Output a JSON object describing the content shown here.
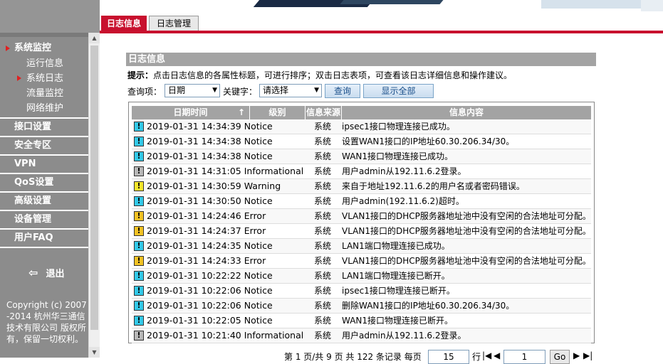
{
  "sidebar": {
    "groups": [
      {
        "label": "系统监控"
      },
      {
        "label": "接口设置"
      },
      {
        "label": "安全专区"
      },
      {
        "label": "VPN"
      },
      {
        "label": "QoS设置"
      },
      {
        "label": "高级设置"
      },
      {
        "label": "设备管理"
      },
      {
        "label": "用户FAQ"
      }
    ],
    "sub_items": [
      {
        "label": "运行信息"
      },
      {
        "label": "系统日志"
      },
      {
        "label": "流量监控"
      },
      {
        "label": "网络维护"
      }
    ],
    "logout_label": "退出",
    "copyright": "Copyright (c) 2007-2014 杭州华三通信技术有限公司 版权所有，保留一切权利。"
  },
  "tabs": [
    {
      "label": "日志信息"
    },
    {
      "label": "日志管理"
    }
  ],
  "panel": {
    "title": "日志信息",
    "tip_prefix": "提示：",
    "tip_text": "点击日志信息的各属性标题，可进行排序；双击日志表项，可查看该日志详细信息和操作建议。",
    "query_label": "查询项：",
    "query_value": "日期",
    "keyword_label": "关键字：",
    "keyword_value": "请选择",
    "search_button": "查询",
    "show_all_button": "显示全部"
  },
  "table": {
    "headers": [
      "日期时间",
      "级别",
      "信息来源",
      "信息内容"
    ],
    "sort_indicator": "↑",
    "rows": [
      {
        "level_icon": "notice-icon",
        "icon_char": "!",
        "datetime": "2019-01-31 14:34:39",
        "level": "Notice",
        "source": "系统",
        "message": "ipsec1接口物理连接已成功。"
      },
      {
        "level_icon": "notice-icon",
        "icon_char": "!",
        "datetime": "2019-01-31 14:34:38",
        "level": "Notice",
        "source": "系统",
        "message": "设置WAN1接口的IP地址60.30.206.34/30。"
      },
      {
        "level_icon": "notice-icon",
        "icon_char": "!",
        "datetime": "2019-01-31 14:34:38",
        "level": "Notice",
        "source": "系统",
        "message": "WAN1接口物理连接已成功。"
      },
      {
        "level_icon": "informational-icon",
        "icon_char": "!",
        "datetime": "2019-01-31 14:31:05",
        "level": "Informational",
        "source": "系统",
        "message": "用户admin从192.11.6.2登录。"
      },
      {
        "level_icon": "warning-icon",
        "icon_char": "!",
        "datetime": "2019-01-31 14:30:59",
        "level": "Warning",
        "source": "系统",
        "message": "来自于地址192.11.6.2的用户名或者密码错误。"
      },
      {
        "level_icon": "notice-icon",
        "icon_char": "!",
        "datetime": "2019-01-31 14:30:50",
        "level": "Notice",
        "source": "系统",
        "message": "用户admin(192.11.6.2)超时。"
      },
      {
        "level_icon": "error-icon",
        "icon_char": "!",
        "datetime": "2019-01-31 14:24:46",
        "level": "Error",
        "source": "系统",
        "message": "VLAN1接口的DHCP服务器地址池中没有空闲的合法地址可分配。"
      },
      {
        "level_icon": "error-icon",
        "icon_char": "!",
        "datetime": "2019-01-31 14:24:37",
        "level": "Error",
        "source": "系统",
        "message": "VLAN1接口的DHCP服务器地址池中没有空闲的合法地址可分配。"
      },
      {
        "level_icon": "notice-icon",
        "icon_char": "!",
        "datetime": "2019-01-31 14:24:35",
        "level": "Notice",
        "source": "系统",
        "message": "LAN1端口物理连接已成功。"
      },
      {
        "level_icon": "error-icon",
        "icon_char": "!",
        "datetime": "2019-01-31 14:24:33",
        "level": "Error",
        "source": "系统",
        "message": "VLAN1接口的DHCP服务器地址池中没有空闲的合法地址可分配。"
      },
      {
        "level_icon": "notice-icon",
        "icon_char": "!",
        "datetime": "2019-01-31 10:22:22",
        "level": "Notice",
        "source": "系统",
        "message": "LAN1端口物理连接已断开。"
      },
      {
        "level_icon": "notice-icon",
        "icon_char": "!",
        "datetime": "2019-01-31 10:22:06",
        "level": "Notice",
        "source": "系统",
        "message": "ipsec1接口物理连接已断开。"
      },
      {
        "level_icon": "notice-icon",
        "icon_char": "!",
        "datetime": "2019-01-31 10:22:06",
        "level": "Notice",
        "source": "系统",
        "message": "删除WAN1接口的IP地址60.30.206.34/30。"
      },
      {
        "level_icon": "notice-icon",
        "icon_char": "!",
        "datetime": "2019-01-31 10:22:05",
        "level": "Notice",
        "source": "系统",
        "message": "WAN1接口物理连接已断开。"
      },
      {
        "level_icon": "informational-icon",
        "icon_char": "!",
        "datetime": "2019-01-31 10:21:40",
        "level": "Informational",
        "source": "系统",
        "message": "用户admin从192.11.6.2登录。"
      }
    ]
  },
  "pager": {
    "text": "第 1 页/共 9 页 共 122 条记录 每页",
    "per_page": "15",
    "rows_label": "行",
    "first": "|◀",
    "prev": "◀",
    "page": "1",
    "go": "Go",
    "next": "▶",
    "last": "▶|"
  }
}
